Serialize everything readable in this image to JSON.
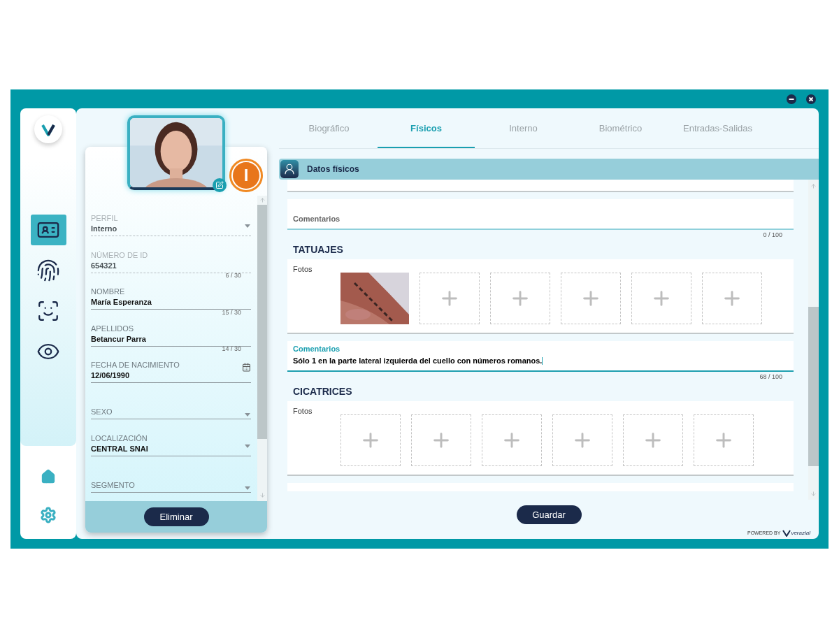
{
  "sidebar": {
    "items": [
      {
        "kind": "id-card",
        "selected": true
      },
      {
        "kind": "fingerprint",
        "selected": false
      },
      {
        "kind": "face-scan",
        "selected": false
      },
      {
        "kind": "eye",
        "selected": false
      }
    ]
  },
  "profile": {
    "status_badge": "I",
    "fields": [
      {
        "kind": "select",
        "label": "PERFIL",
        "value": "Interno",
        "disabled": true
      },
      {
        "kind": "text",
        "label": "NÚMERO DE ID",
        "value": "654321",
        "counter": "6 / 30",
        "disabled": true
      },
      {
        "kind": "text",
        "label": "NOMBRE",
        "value": "María Esperanza",
        "counter": "15 / 30",
        "disabled": false
      },
      {
        "kind": "text",
        "label": "APELLIDOS",
        "value": "Betancur Parra",
        "counter": "14 / 30",
        "disabled": false
      },
      {
        "kind": "date",
        "label": "FECHA DE NACIMIENTO",
        "value": "12/06/1990",
        "disabled": false
      },
      {
        "kind": "select",
        "label": "SEXO",
        "disabled": false
      },
      {
        "kind": "select",
        "label": "LOCALIZACIÓN",
        "value": "CENTRAL SNAI",
        "disabled": false
      },
      {
        "kind": "select",
        "label": "SEGMENTO",
        "disabled": false
      }
    ],
    "delete_button": "Eliminar"
  },
  "tabs": [
    {
      "label": "Biográfico",
      "selected": false
    },
    {
      "label": "Físicos",
      "selected": true
    },
    {
      "label": "Interno",
      "selected": false
    },
    {
      "label": "Biométrico",
      "selected": false
    },
    {
      "label": "Entradas-Salidas",
      "selected": false
    }
  ],
  "section": {
    "title": "Datos físicos",
    "blocks": [
      {
        "kind": "comment",
        "label": "Comentarios",
        "counter": "0 / 100",
        "focused": false
      },
      {
        "kind": "heading",
        "text": "TATUAJES"
      },
      {
        "kind": "photos",
        "label": "Fotos",
        "slots": [
          {
            "kind": "picture"
          },
          {
            "kind": "empty"
          },
          {
            "kind": "empty"
          },
          {
            "kind": "empty"
          },
          {
            "kind": "empty"
          },
          {
            "kind": "empty"
          }
        ]
      },
      {
        "kind": "comment",
        "label": "Comentarios",
        "value": "Sólo 1 en la parte lateral izquierda del cuello con números romanos.",
        "counter": "68 / 100",
        "focused": true
      },
      {
        "kind": "heading",
        "text": "CICATRICES"
      },
      {
        "kind": "photos",
        "label": "Fotos",
        "slots": [
          {
            "kind": "empty"
          },
          {
            "kind": "empty"
          },
          {
            "kind": "empty"
          },
          {
            "kind": "empty"
          },
          {
            "kind": "empty"
          },
          {
            "kind": "empty"
          }
        ]
      }
    ]
  },
  "save_button": "Guardar",
  "footer": {
    "powered_by": "POWERED BY",
    "brand": "verazial"
  }
}
